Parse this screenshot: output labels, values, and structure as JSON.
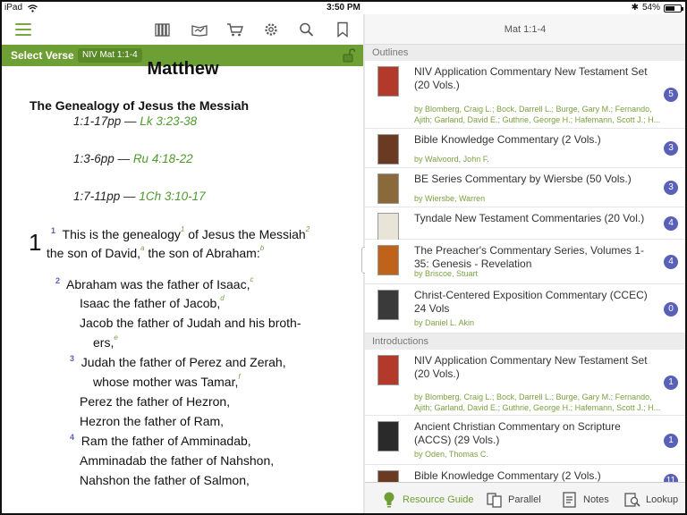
{
  "status_bar": {
    "device": "iPad",
    "time": "3:50 PM",
    "battery": "54%",
    "battery_level": 0.54
  },
  "toolbar": {
    "menu_icon": "hamburger-menu-icon",
    "icons": [
      "library-icon",
      "reading-plans-icon",
      "cart-icon",
      "gear-icon",
      "search-icon",
      "bookmark-icon"
    ]
  },
  "verse_bar": {
    "label": "Select Verse",
    "reference": "NIV Mat 1:1-4",
    "lock_icon": "lock-icon"
  },
  "bible_text": {
    "book_title": "Matthew",
    "heading": "The Genealogy of Jesus the Messiah",
    "cross_refs": [
      {
        "ref": "1:1-17pp",
        "sep": " — ",
        "link": "Lk 3:23-38"
      },
      {
        "ref": "1:3-6pp",
        "sep": " — ",
        "link": "Ru 4:18-22"
      },
      {
        "ref": "1:7-11pp",
        "sep": " — ",
        "link": "1Ch 3:10-17"
      }
    ],
    "chapter": "1",
    "lines": [
      {
        "vnum": "1",
        "text": "This is the genealogy",
        "fn": "1",
        "text2": " of Jesus the Messiah",
        "fn2": "2"
      },
      {
        "text": "the son of David,",
        "fn": "a",
        "text2": " the son of Abraham:",
        "fn2": "b"
      },
      {
        "vnum": "2",
        "text": "Abraham was the father of Isaac,",
        "fn": "c"
      },
      {
        "text": "Isaac the father of Jacob,",
        "fn": "d"
      },
      {
        "text": "Jacob the father of Judah and his broth-"
      },
      {
        "text": "ers,",
        "fn": "e"
      },
      {
        "vnum": "3",
        "text": "Judah the father of Perez and Zerah,"
      },
      {
        "text": "whose mother was Tamar,",
        "fn": "f"
      },
      {
        "text": "Perez the father of Hezron,"
      },
      {
        "text": "Hezron the father of Ram,"
      },
      {
        "vnum": "4",
        "text": "Ram the father of Amminadab,"
      },
      {
        "text": "Amminadab the father of Nahshon,"
      },
      {
        "text": "Nahshon the father of Salmon,"
      }
    ]
  },
  "guide": {
    "header": "Mat 1:1-4",
    "sections": [
      {
        "name": "Outlines",
        "items": [
          {
            "title": "NIV Application Commentary New Testament Set (20 Vols.)",
            "authors": "by Blomberg, Craig L.; Bock, Darrell L.; Burge, Gary M.; Fernando, Ajith; Garland, David E.; Guthrie, George H.; Hafemann, Scott J.; H...",
            "count": "5",
            "thumb_color": "#b33a2a"
          },
          {
            "title": "Bible Knowledge Commentary (2 Vols.)",
            "authors": "by Walvoord, John F.",
            "count": "3",
            "thumb_color": "#6b3a22"
          },
          {
            "title": "BE Series Commentary by Wiersbe (50 Vols.)",
            "authors": "by Wiersbe, Warren",
            "count": "3",
            "thumb_color": "#8a6a3a"
          },
          {
            "title": "Tyndale New Testament Commentaries (20 Vol.)",
            "authors": "",
            "count": "4",
            "thumb_color": "#e8e4d8"
          },
          {
            "title": "The Preacher's Commentary Series, Volumes 1-35: Genesis - Revelation",
            "authors": "by Briscoe, Stuart",
            "count": "4",
            "thumb_color": "#c0631a"
          },
          {
            "title": "Christ-Centered Exposition Commentary (CCEC) 24 Vols",
            "authors": "by Daniel L. Akin",
            "count": "0",
            "thumb_color": "#3a3a3a"
          }
        ]
      },
      {
        "name": "Introductions",
        "items": [
          {
            "title": "NIV Application Commentary New Testament Set (20 Vols.)",
            "authors": "by Blomberg, Craig L.; Bock, Darrell L.; Burge, Gary M.; Fernando, Ajith; Garland, David E.; Guthrie, George H.; Hafemann, Scott J.; H...",
            "count": "1",
            "thumb_color": "#b33a2a"
          },
          {
            "title": "Ancient Christian Commentary on Scripture (ACCS) (29 Vols.)",
            "authors": "by Oden, Thomas C.",
            "count": "1",
            "thumb_color": "#2a2a2a"
          },
          {
            "title": "Bible Knowledge Commentary (2 Vols.)",
            "authors": "",
            "count": "11",
            "thumb_color": "#6b3a22"
          }
        ]
      }
    ]
  },
  "tabs": [
    {
      "label": "Resource Guide",
      "icon": "lightbulb-icon",
      "active": true
    },
    {
      "label": "Parallel",
      "icon": "parallel-books-icon",
      "active": false
    },
    {
      "label": "Notes",
      "icon": "notes-icon",
      "active": false
    },
    {
      "label": "Lookup",
      "icon": "lookup-icon",
      "active": false
    }
  ],
  "colors": {
    "accent_green": "#6e9f35",
    "link_green": "#4f9a2e",
    "badge_purple": "#5960b8"
  }
}
